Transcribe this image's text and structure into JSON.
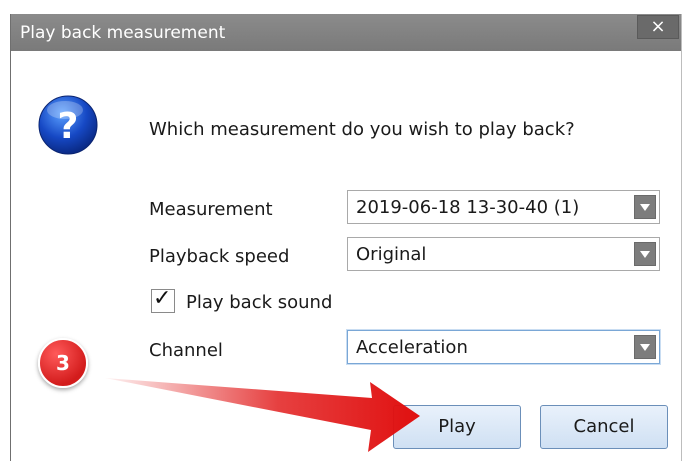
{
  "dialog": {
    "title": "Play back measurement",
    "close_label": "×",
    "icon": "question-help-icon",
    "question": "Which measurement do you wish to play back?"
  },
  "fields": {
    "measurement_label": "Measurement",
    "measurement_value": "2019-06-18 13-30-40 (1)",
    "speed_label": "Playback speed",
    "speed_value": "Original",
    "sound_label": "Play back sound",
    "sound_checked": true,
    "channel_label": "Channel",
    "channel_value": "Acceleration"
  },
  "buttons": {
    "play_label": "Play",
    "cancel_label": "Cancel"
  },
  "annotation": {
    "step_number": "3",
    "badge_color": "#d31c1c",
    "arrow_color": "#e01010"
  }
}
